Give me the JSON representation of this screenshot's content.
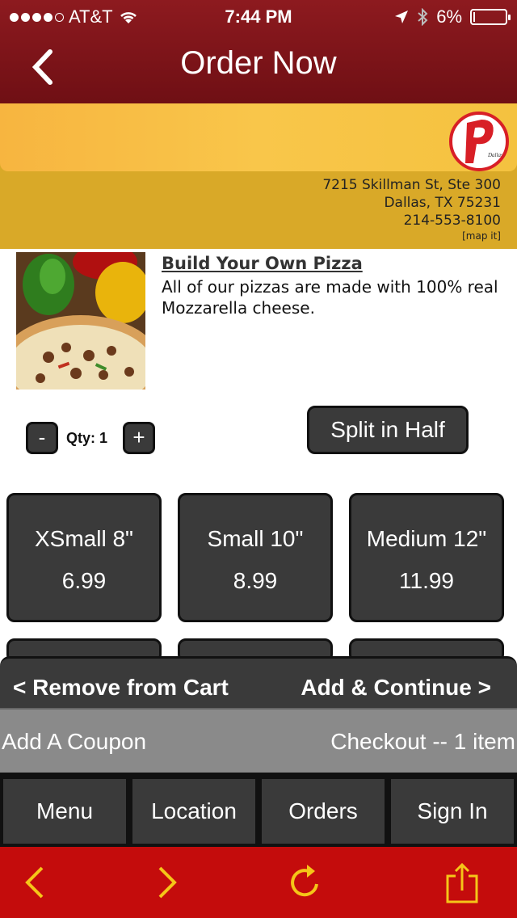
{
  "status_bar": {
    "carrier": "AT&T",
    "time": "7:44 PM",
    "battery": "6%",
    "battery_level": 0.06,
    "signal_icon": "signal-dots",
    "wifi_icon": "wifi-icon",
    "location_icon": "location-arrow-icon",
    "bluetooth_icon": "bluetooth-icon"
  },
  "nav": {
    "title": "Order Now",
    "back_icon": "chevron-left-icon"
  },
  "restaurant": {
    "address_line1": "7215 Skillman St, Ste 300",
    "address_line2": "Dallas, TX 75231",
    "phone": "214-553-8100",
    "map_link": "[map it]",
    "logo_text": "Dallas Style Pizza"
  },
  "item": {
    "title": "Build Your Own Pizza",
    "description": "All of our pizzas are made with 100% real Mozzarella cheese."
  },
  "qty": {
    "minus": "-",
    "plus": "+",
    "label": "Qty: 1"
  },
  "split_label": "Split in Half",
  "sizes": [
    {
      "name": "XSmall 8\"",
      "price": "6.99"
    },
    {
      "name": "Small 10\"",
      "price": "8.99"
    },
    {
      "name": "Medium 12\"",
      "price": "11.99"
    }
  ],
  "cart": {
    "remove": "< Remove from Cart",
    "add": "Add & Continue >"
  },
  "coupon": {
    "add": "Add A Coupon",
    "checkout": "Checkout -- 1 item"
  },
  "tabs": [
    "Menu",
    "Location",
    "Orders",
    "Sign In"
  ],
  "browser": {
    "back_icon": "chevron-left-icon",
    "forward_icon": "chevron-right-icon",
    "reload_icon": "reload-icon",
    "share_icon": "share-icon",
    "icon_color": "#f5c518"
  },
  "colors": {
    "nav": "#7a1217",
    "banner": "#d9a928",
    "buttons": "#3a3a3a",
    "safari_bar": "#c40c0c"
  }
}
